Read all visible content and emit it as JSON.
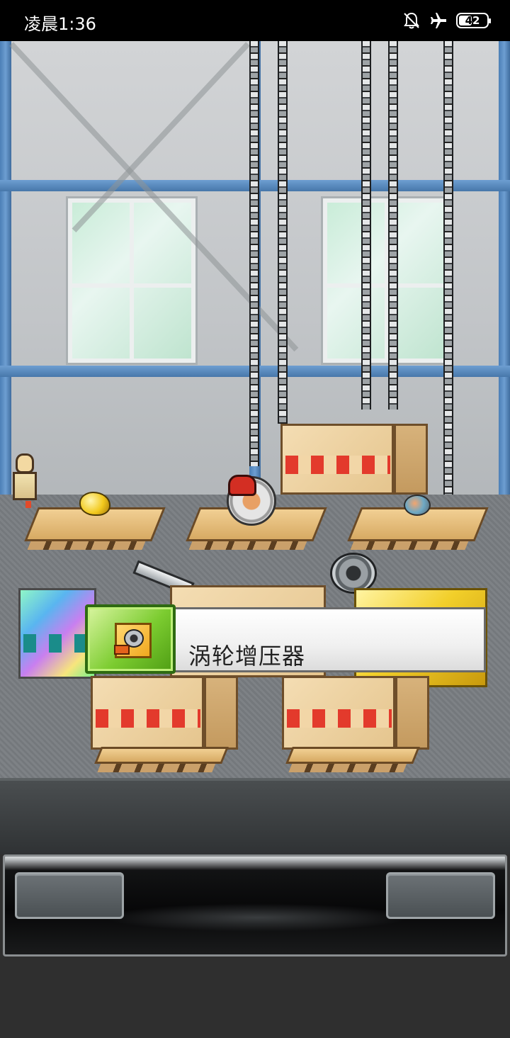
{
  "status_bar": {
    "time": "凌晨1:36",
    "icons": [
      "bell-off-icon",
      "airplane-mode-icon",
      "battery-icon"
    ],
    "battery_level": "42"
  },
  "scene": {
    "location": "warehouse",
    "colors": {
      "wall_beam": "#5a8cc3",
      "crate_check": "#e33a2c",
      "popup_tile": "#7ccc30"
    }
  },
  "item_popup": {
    "item_name": "涡轮增压器",
    "icon": "turbocharger-icon"
  },
  "control_panel": {
    "left_button_label": "",
    "right_button_label": ""
  }
}
